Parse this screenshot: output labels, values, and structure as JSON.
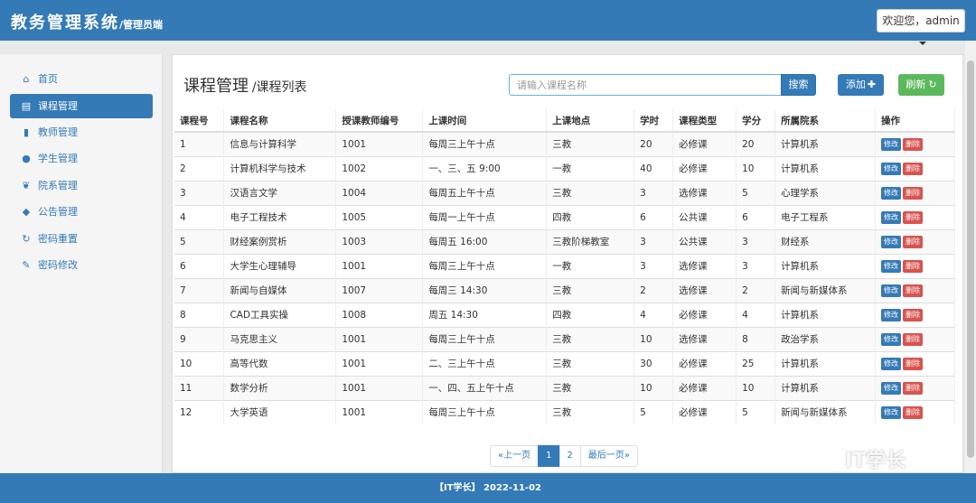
{
  "header": {
    "title": "教务管理系统",
    "subtitle": "/管理员端",
    "user_menu": "欢迎您，admin"
  },
  "sidebar": {
    "items": [
      {
        "label": "首页",
        "icon": "home-icon",
        "glyph": "⌂"
      },
      {
        "label": "课程管理",
        "icon": "list-icon",
        "glyph": "▤"
      },
      {
        "label": "教师管理",
        "icon": "book-icon",
        "glyph": "▮"
      },
      {
        "label": "学生管理",
        "icon": "user-icon",
        "glyph": "●"
      },
      {
        "label": "院系管理",
        "icon": "leaf-icon",
        "glyph": "❦"
      },
      {
        "label": "公告管理",
        "icon": "tags-icon",
        "glyph": "◆"
      },
      {
        "label": "密码重置",
        "icon": "refresh-icon",
        "glyph": "↻"
      },
      {
        "label": "密码修改",
        "icon": "pencil-icon",
        "glyph": "✎"
      }
    ]
  },
  "main": {
    "title": "课程管理",
    "subtitle": "/课程列表",
    "search_placeholder": "请输入课程名称",
    "search_label": "搜索",
    "add_label": "添加",
    "refresh_label": "刷新",
    "edit_label": "修改",
    "delete_label": "删除"
  },
  "table": {
    "columns": [
      "课程号",
      "课程名称",
      "授课教师编号",
      "上课时间",
      "上课地点",
      "学时",
      "课程类型",
      "学分",
      "所属院系",
      "操作"
    ],
    "rows": [
      [
        "1",
        "信息与计算科学",
        "1001",
        "每周三上午十点",
        "三教",
        "20",
        "必修课",
        "20",
        "计算机系"
      ],
      [
        "2",
        "计算机科学与技术",
        "1002",
        "一、三、五 9:00",
        "一教",
        "40",
        "必修课",
        "10",
        "计算机系"
      ],
      [
        "3",
        "汉语言文学",
        "1004",
        "每周五上午十点",
        "三教",
        "3",
        "选修课",
        "5",
        "心理学系"
      ],
      [
        "4",
        "电子工程技术",
        "1005",
        "每周一上午十点",
        "四教",
        "6",
        "公共课",
        "6",
        "电子工程系"
      ],
      [
        "5",
        "财经案例赏析",
        "1003",
        "每周五 16:00",
        "三教阶梯教室",
        "3",
        "公共课",
        "3",
        "财经系"
      ],
      [
        "6",
        "大学生心理辅导",
        "1001",
        "每周三上午十点",
        "一教",
        "3",
        "选修课",
        "3",
        "计算机系"
      ],
      [
        "7",
        "新闻与自媒体",
        "1007",
        "每周三 14:30",
        "三教",
        "2",
        "选修课",
        "2",
        "新闻与新媒体系"
      ],
      [
        "8",
        "CAD工具实操",
        "1008",
        "周五 14:30",
        "四教",
        "4",
        "必修课",
        "4",
        "计算机系"
      ],
      [
        "9",
        "马克思主义",
        "1001",
        "每周三上午十点",
        "三教",
        "10",
        "选修课",
        "8",
        "政治学系"
      ],
      [
        "10",
        "高等代数",
        "1001",
        "二、三上午十点",
        "三教",
        "30",
        "必修课",
        "25",
        "计算机系"
      ],
      [
        "11",
        "数学分析",
        "1001",
        "一、四、五上午十点",
        "三教",
        "10",
        "必修课",
        "10",
        "计算机系"
      ],
      [
        "12",
        "大学英语",
        "1001",
        "每周三上午十点",
        "三教",
        "5",
        "必修课",
        "5",
        "新闻与新媒体系"
      ]
    ]
  },
  "pagination": {
    "prev": "«上一页",
    "pages": [
      "1",
      "2"
    ],
    "current": "1",
    "last": "最后一页»"
  },
  "footer": {
    "text": "【IT学长】 2022-11-02"
  },
  "watermark": "IT学长",
  "colors": {
    "primary": "#337ab7",
    "success": "#5cb85c",
    "danger": "#d9534f"
  }
}
